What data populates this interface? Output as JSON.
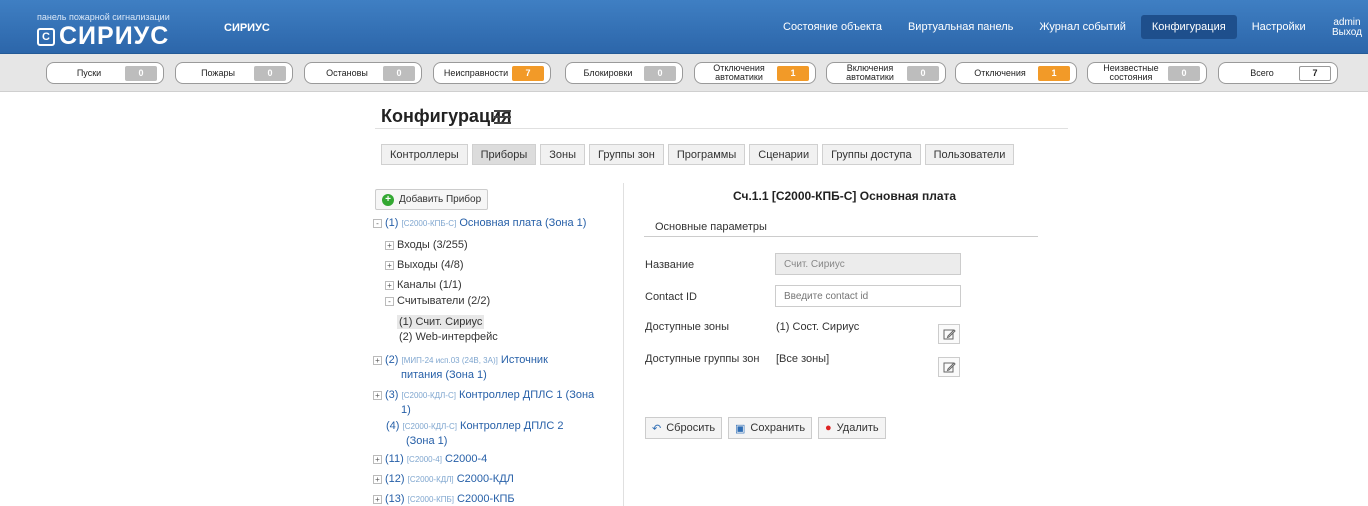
{
  "header": {
    "brand_sub": "панель пожарной сигнализации",
    "brand_mark": "С",
    "brand_word": "СИРИУС",
    "brand_small": "СИРИУС",
    "nav": [
      {
        "label": "Состояние объекта"
      },
      {
        "label": "Виртуальная панель"
      },
      {
        "label": "Журнал событий"
      },
      {
        "label": "Конфигурация",
        "active": true
      },
      {
        "label": "Настройки"
      }
    ],
    "user": "admin",
    "logout": "Выход"
  },
  "counters": [
    {
      "label": "Пуски",
      "value": "0",
      "color": "gray"
    },
    {
      "label": "Пожары",
      "value": "0",
      "color": "gray"
    },
    {
      "label": "Остановы",
      "value": "0",
      "color": "gray"
    },
    {
      "label": "Неисправности",
      "value": "7",
      "color": "orange"
    },
    {
      "label": "Блокировки",
      "value": "0",
      "color": "gray"
    },
    {
      "label": "Отключения автоматики",
      "value": "1",
      "color": "orange"
    },
    {
      "label": "Включения автоматики",
      "value": "0",
      "color": "gray"
    },
    {
      "label": "Отключения",
      "value": "1",
      "color": "orange"
    },
    {
      "label": "Неизвестные состояния",
      "value": "0",
      "color": "gray"
    },
    {
      "label": "Всего",
      "value": "7",
      "color": "white"
    }
  ],
  "page": {
    "title": "Конфигурация",
    "tabs": [
      {
        "label": "Контроллеры"
      },
      {
        "label": "Приборы",
        "active": true
      },
      {
        "label": "Зоны"
      },
      {
        "label": "Группы зон"
      },
      {
        "label": "Программы"
      },
      {
        "label": "Сценарии"
      },
      {
        "label": "Группы доступа"
      },
      {
        "label": "Пользователи"
      }
    ]
  },
  "tree": {
    "add_label": "Добавить Прибор",
    "n1_num": "(1)",
    "n1_type": "[С2000-КПБ-С]",
    "n1_name": "Основная плата (Зона 1)",
    "inputs": "Входы (3/255)",
    "outputs": "Выходы (4/8)",
    "channels": "Каналы (1/1)",
    "readers": "Считыватели (2/2)",
    "reader1": "(1) Счит. Сириус",
    "reader2": "(2) Web-интерфейс",
    "n2_num": "(2)",
    "n2_type": "[МИП-24 исп.03 (24В, 3А)]",
    "n2_name_a": "Источник",
    "n2_name_b": "питания (Зона 1)",
    "n3_num": "(3)",
    "n3_type": "[С2000-КДЛ-С]",
    "n3_name_a": "Контроллер ДПЛС 1 (Зона",
    "n3_name_b": "1)",
    "n4_num": "(4)",
    "n4_type": "[С2000-КДЛ-С]",
    "n4_name_a": "Контроллер ДПЛС 2",
    "n4_name_b": "(Зона 1)",
    "n11_num": "(11)",
    "n11_type": "[С2000-4]",
    "n11_name": "С2000-4",
    "n12_num": "(12)",
    "n12_type": "[С2000-КДЛ]",
    "n12_name": "С2000-КДЛ",
    "n13_num": "(13)",
    "n13_type": "[С2000-КПБ]",
    "n13_name": "С2000-КПБ"
  },
  "detail": {
    "title": "Сч.1.1 [С2000-КПБ-С] Основная плата",
    "section": "Основные параметры",
    "name_label": "Название",
    "name_value": "Счит. Сириус",
    "cid_label": "Contact ID",
    "cid_placeholder": "Введите contact id",
    "zones_label": "Доступные зоны",
    "zones_value": "(1) Сост. Сириус",
    "groups_label": "Доступные группы зон",
    "groups_value": "[Все зоны]",
    "reset": "Сбросить",
    "save": "Сохранить",
    "delete": "Удалить"
  }
}
